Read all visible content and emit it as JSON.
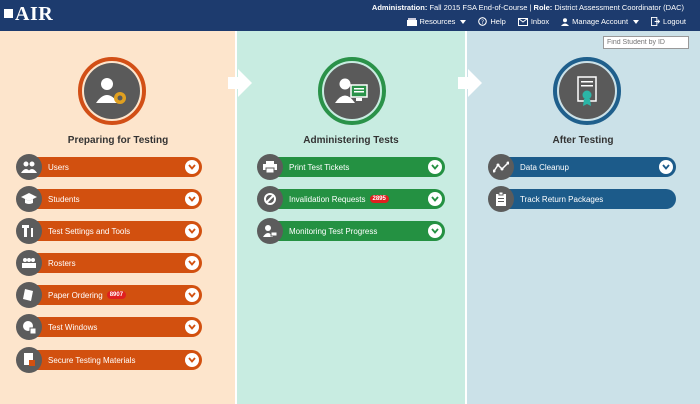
{
  "header": {
    "logo": "AIR",
    "admin_label": "Administration:",
    "admin_value": "Fall 2015 FSA End-of-Course",
    "role_label": "Role:",
    "role_value": "District Assessment Coordinator (DAC)",
    "nav": {
      "resources": "Resources",
      "help": "Help",
      "inbox": "Inbox",
      "manage_account": "Manage Account",
      "logout": "Logout"
    }
  },
  "find_student": {
    "placeholder": "Find Student by ID"
  },
  "columns": [
    {
      "title": "Preparing for Testing",
      "color": "#d2500f",
      "items": [
        {
          "label": "Users",
          "icon": "users-icon"
        },
        {
          "label": "Students",
          "icon": "graduation-cap-icon"
        },
        {
          "label": "Test Settings and Tools",
          "icon": "tools-icon"
        },
        {
          "label": "Rosters",
          "icon": "group-icon"
        },
        {
          "label": "Paper Ordering",
          "icon": "paper-icon",
          "count": "8907"
        },
        {
          "label": "Test Windows",
          "icon": "calendar-icon"
        },
        {
          "label": "Secure Testing Materials",
          "icon": "secure-doc-icon"
        }
      ]
    },
    {
      "title": "Administering Tests",
      "color": "#249142",
      "items": [
        {
          "label": "Print Test Tickets",
          "icon": "printer-icon"
        },
        {
          "label": "Invalidation Requests",
          "icon": "invalid-icon",
          "count": "2895"
        },
        {
          "label": "Monitoring Test Progress",
          "icon": "monitor-icon"
        }
      ]
    },
    {
      "title": "After Testing",
      "color": "#1c5b8a",
      "items": [
        {
          "label": "Data Cleanup",
          "icon": "chart-line-icon"
        },
        {
          "label": "Track Return Packages",
          "icon": "clipboard-icon"
        }
      ]
    }
  ]
}
